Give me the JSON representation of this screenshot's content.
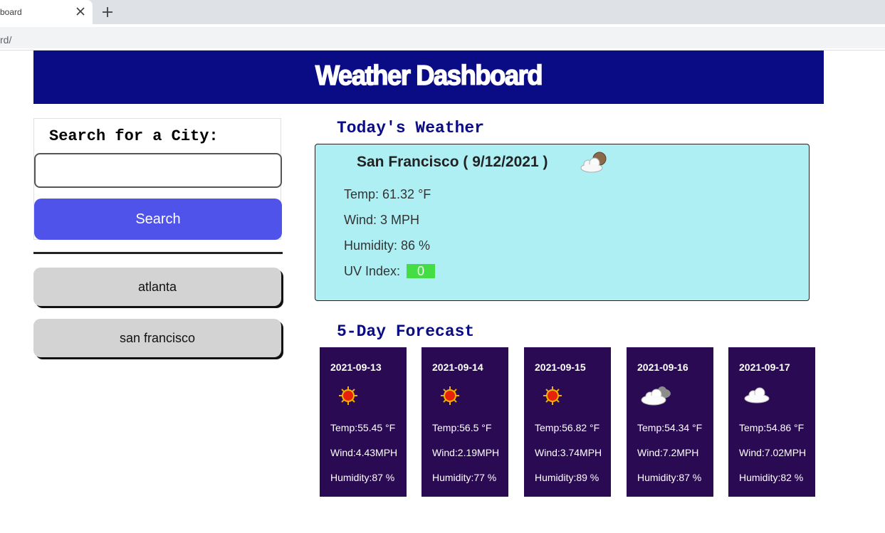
{
  "browser": {
    "tab_title": "board",
    "url": "rd/"
  },
  "header": {
    "title": "Weather Dashboard"
  },
  "search": {
    "title": "Search for a City:",
    "input_value": "",
    "button_label": "Search"
  },
  "history": [
    "atlanta",
    "san francisco"
  ],
  "today": {
    "section_title": "Today's Weather",
    "city_line": "San Francisco ( 9/12/2021 )",
    "icon": "partly-cloudy-icon",
    "temp": "Temp: 61.32 °F",
    "wind": "Wind: 3 MPH",
    "humidity": "Humidity: 86 %",
    "uv_label": "UV Index:",
    "uv_value": "0",
    "uv_color": "#44dd44"
  },
  "forecast": {
    "section_title": "5-Day Forecast",
    "days": [
      {
        "date": "2021-09-13",
        "icon": "sun-icon",
        "temp": "Temp:55.45 °F",
        "wind": "Wind:4.43MPH",
        "humidity": "Humidity:87 %"
      },
      {
        "date": "2021-09-14",
        "icon": "sun-icon",
        "temp": "Temp:56.5 °F",
        "wind": "Wind:2.19MPH",
        "humidity": "Humidity:77 %"
      },
      {
        "date": "2021-09-15",
        "icon": "sun-icon",
        "temp": "Temp:56.82 °F",
        "wind": "Wind:3.74MPH",
        "humidity": "Humidity:89 %"
      },
      {
        "date": "2021-09-16",
        "icon": "cloudy-icon",
        "temp": "Temp:54.34 °F",
        "wind": "Wind:7.2MPH",
        "humidity": "Humidity:87 %"
      },
      {
        "date": "2021-09-17",
        "icon": "cloud-icon",
        "temp": "Temp:54.86 °F",
        "wind": "Wind:7.02MPH",
        "humidity": "Humidity:82 %"
      }
    ]
  },
  "colors": {
    "header_bg": "#0a0c85",
    "search_button": "#5053ea",
    "today_bg": "#aeeff4",
    "forecast_bg": "#2a0a52"
  }
}
